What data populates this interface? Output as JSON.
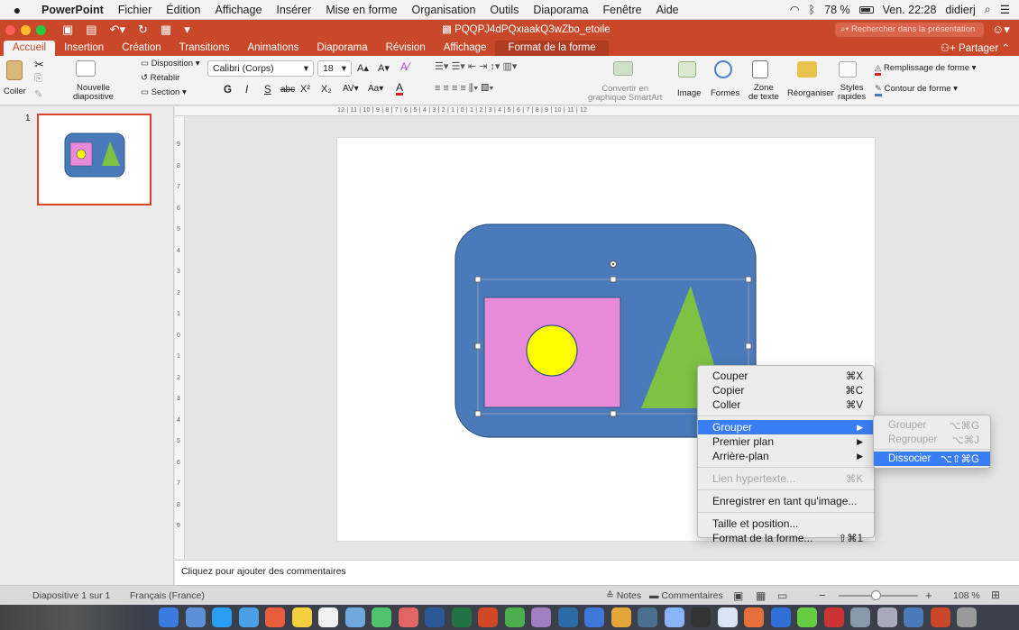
{
  "menubar": {
    "apple_icon": "apple-icon",
    "items": [
      "PowerPoint",
      "Fichier",
      "Édition",
      "Affichage",
      "Insérer",
      "Mise en forme",
      "Organisation",
      "Outils",
      "Diaporama",
      "Fenêtre",
      "Aide"
    ],
    "battery": "78 %",
    "clock": "Ven. 22:28",
    "user": "didierj"
  },
  "titlebar": {
    "doc_title": "PQQPJ4dPQxiaakQ3wZbo_etoile",
    "search_placeholder": "Rechercher dans la présentation"
  },
  "tabs": [
    "Accueil",
    "Insertion",
    "Création",
    "Transitions",
    "Animations",
    "Diaporama",
    "Révision",
    "Affichage",
    "Format de la forme"
  ],
  "share_label": "Partager",
  "ribbon": {
    "coller": "Coller",
    "nouvelle": "Nouvelle",
    "diapositive": "diapositive",
    "disposition": "Disposition",
    "retablir": "Rétablir",
    "section": "Section",
    "font_name": "Calibri (Corps)",
    "font_size": "18",
    "bold": "G",
    "italic": "I",
    "underline": "S",
    "strike": "abc",
    "convertir1": "Convertir en",
    "convertir2": "graphique SmartArt",
    "image": "Image",
    "formes": "Formes",
    "zone1": "Zone",
    "zone2": "de texte",
    "reorganiser": "Réorganiser",
    "styles1": "Styles",
    "styles2": "rapides",
    "remplissage": "Remplissage de forme",
    "contour": "Contour de forme"
  },
  "ruler": {
    "h": "12 | 11 | 10 | 9 | 8 | 7 | 6 | 5 | 4 | 3 | 2 | 1 | 0 | 1 | 2 | 3 | 4 | 5 | 6 | 7 | 8 | 9 | 10 | 11 | 12",
    "v": [
      "9",
      "8",
      "7",
      "6",
      "5",
      "4",
      "3",
      "2",
      "1",
      "0",
      "1",
      "2",
      "3",
      "4",
      "5",
      "6",
      "7",
      "8",
      "9"
    ]
  },
  "thumb_number": "1",
  "notes_placeholder": "Cliquez pour ajouter des commentaires",
  "status": {
    "slide": "Diapositive 1 sur 1",
    "language": "Français (France)",
    "notes": "Notes",
    "comments": "Commentaires",
    "zoom": "108 %"
  },
  "context_menu": {
    "items": [
      {
        "label": "Couper",
        "shortcut": "⌘X"
      },
      {
        "label": "Copier",
        "shortcut": "⌘C"
      },
      {
        "label": "Coller",
        "shortcut": "⌘V"
      },
      {
        "label": "Grouper",
        "shortcut": "▶"
      },
      {
        "label": "Premier plan",
        "shortcut": "▶"
      },
      {
        "label": "Arrière-plan",
        "shortcut": "▶"
      },
      {
        "label": "Lien hypertexte...",
        "shortcut": "⌘K"
      },
      {
        "label": "Enregistrer en tant qu'image...",
        "shortcut": ""
      },
      {
        "label": "Taille et position...",
        "shortcut": ""
      },
      {
        "label": "Format de la forme...",
        "shortcut": "⇧⌘1"
      }
    ]
  },
  "submenu": {
    "items": [
      {
        "label": "Grouper",
        "shortcut": "⌥⌘G"
      },
      {
        "label": "Regrouper",
        "shortcut": "⌥⌘J"
      },
      {
        "label": "Dissocier",
        "shortcut": "⌥⇧⌘G"
      }
    ]
  },
  "colors": {
    "accent": "#c9482a",
    "shape_blue": "#4a7ab9",
    "rect_pink": "#e88ad9",
    "circle_yellow": "#ffff00",
    "triangle_green": "#7dc242",
    "highlight": "#3a7ef5"
  }
}
